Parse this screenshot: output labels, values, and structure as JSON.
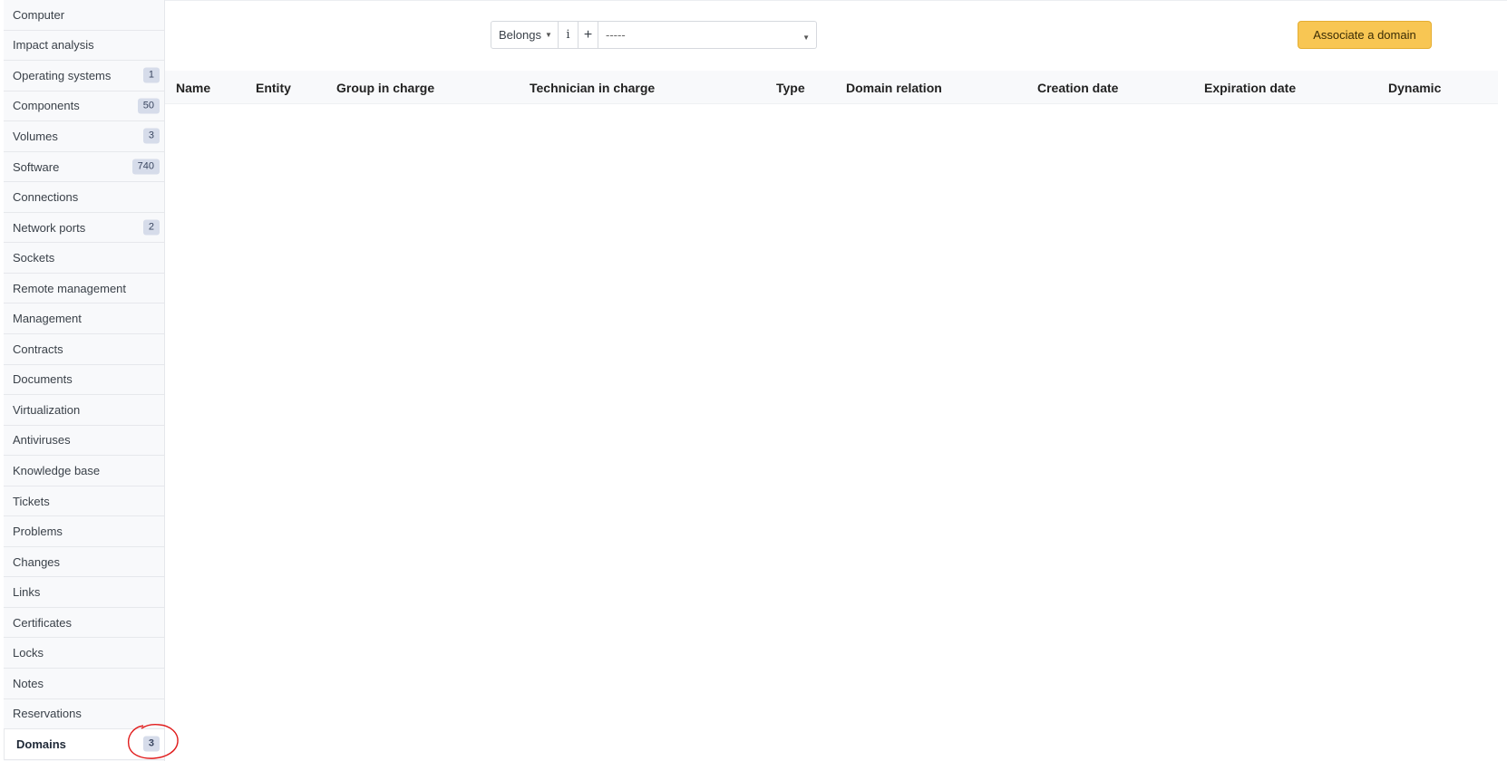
{
  "sidebar": {
    "items": [
      {
        "label": "Computer",
        "badge": ""
      },
      {
        "label": "Impact analysis",
        "badge": ""
      },
      {
        "label": "Operating systems",
        "badge": "1"
      },
      {
        "label": "Components",
        "badge": "50"
      },
      {
        "label": "Volumes",
        "badge": "3"
      },
      {
        "label": "Software",
        "badge": "740"
      },
      {
        "label": "Connections",
        "badge": ""
      },
      {
        "label": "Network ports",
        "badge": "2"
      },
      {
        "label": "Sockets",
        "badge": ""
      },
      {
        "label": "Remote management",
        "badge": ""
      },
      {
        "label": "Management",
        "badge": ""
      },
      {
        "label": "Contracts",
        "badge": ""
      },
      {
        "label": "Documents",
        "badge": ""
      },
      {
        "label": "Virtualization",
        "badge": ""
      },
      {
        "label": "Antiviruses",
        "badge": ""
      },
      {
        "label": "Knowledge base",
        "badge": ""
      },
      {
        "label": "Tickets",
        "badge": ""
      },
      {
        "label": "Problems",
        "badge": ""
      },
      {
        "label": "Changes",
        "badge": ""
      },
      {
        "label": "Links",
        "badge": ""
      },
      {
        "label": "Certificates",
        "badge": ""
      },
      {
        "label": "Locks",
        "badge": ""
      },
      {
        "label": "Notes",
        "badge": ""
      },
      {
        "label": "Reservations",
        "badge": ""
      },
      {
        "label": "Domains",
        "badge": "3",
        "active": true
      }
    ]
  },
  "toolbar": {
    "belongs_label": "Belongs",
    "info_label": "i",
    "add_label": "+",
    "domain_select_value": "-----",
    "associate_button_label": "Associate a domain"
  },
  "table": {
    "columns": [
      "Name",
      "Entity",
      "Group in charge",
      "Technician in charge",
      "Type",
      "Domain relation",
      "Creation date",
      "Expiration date",
      "Dynamic"
    ],
    "rows": []
  },
  "colors": {
    "accent_button": "#f8c653",
    "badge_bg": "#d6dcea",
    "annotation": "#e11d1d"
  }
}
